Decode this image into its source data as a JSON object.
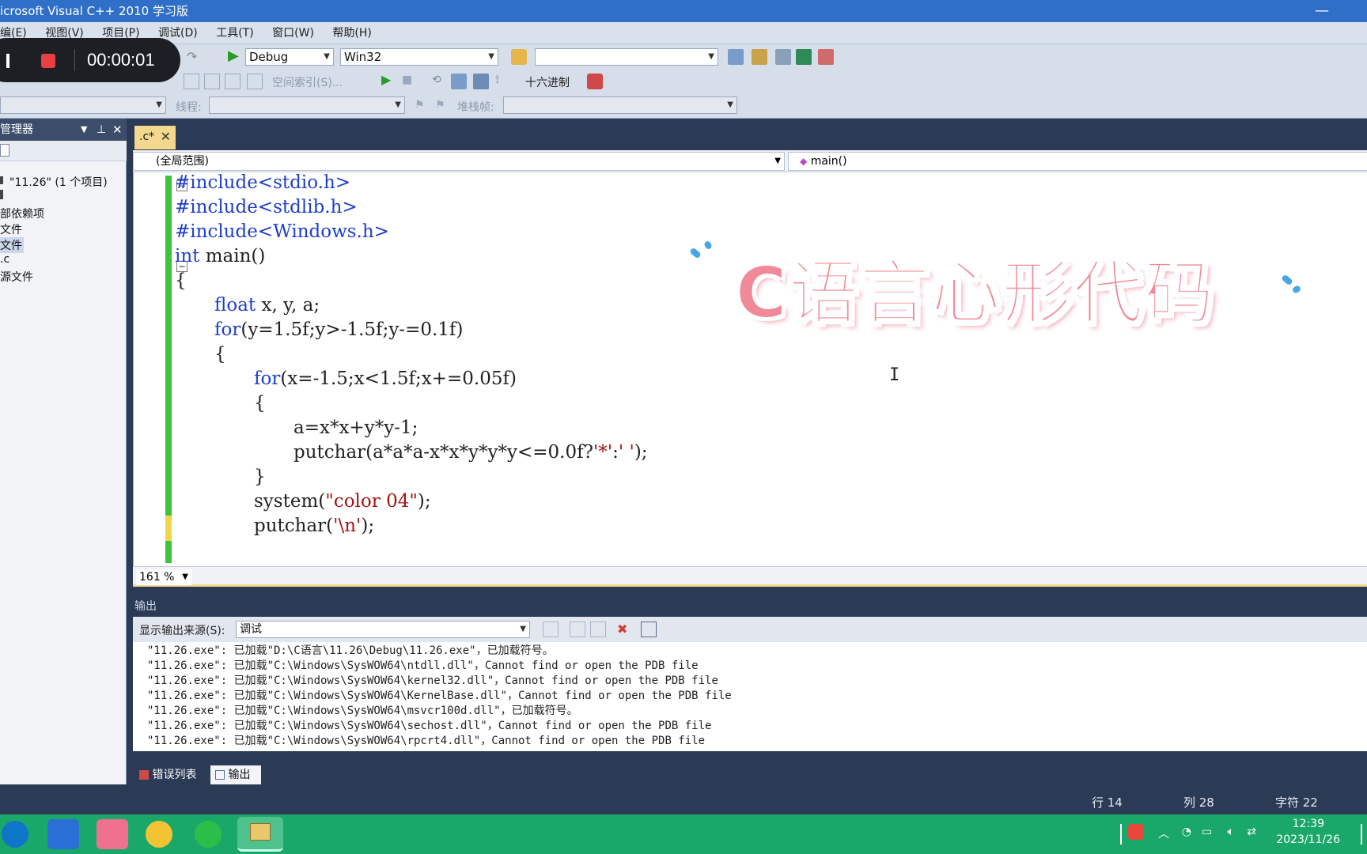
{
  "window": {
    "title": "icrosoft Visual C++ 2010 学习版"
  },
  "menu": [
    "编(E)",
    "视图(V)",
    "项目(P)",
    "调试(D)",
    "工具(T)",
    "窗口(W)",
    "帮助(H)"
  ],
  "recorder": {
    "time": "00:00:01"
  },
  "toolbar": {
    "config": "Debug",
    "platform": "Win32",
    "find_value": "",
    "index_label": "空间索引(S)...",
    "hex_label": "十六进制",
    "thread_label": "线程:",
    "stack_label": "堆栈帧:"
  },
  "solution_explorer": {
    "title": "管理器",
    "items": [
      {
        "label": "\"11.26\" (1 个项目)"
      },
      {
        "label": ""
      },
      {
        "label": "部依赖项"
      },
      {
        "label": "文件"
      },
      {
        "label": "文件"
      },
      {
        "label": ".c"
      },
      {
        "label": "源文件"
      }
    ]
  },
  "editor": {
    "tab_label": ".c*",
    "scope": "(全局范围)",
    "function": "main()",
    "zoom": "161 %",
    "lines": [
      {
        "indent": 0,
        "parts": [
          [
            "pp",
            "#include<stdio.h>"
          ]
        ]
      },
      {
        "indent": 0,
        "parts": [
          [
            "pp",
            "#include<stdlib.h>"
          ]
        ]
      },
      {
        "indent": 0,
        "parts": [
          [
            "pp",
            "#include<Windows.h>"
          ]
        ]
      },
      {
        "indent": 0,
        "parts": [
          [
            "kw",
            "int"
          ],
          [
            "",
            " main()"
          ]
        ]
      },
      {
        "indent": 0,
        "parts": [
          [
            "",
            "{"
          ]
        ]
      },
      {
        "indent": 1,
        "parts": [
          [
            "kw",
            "float"
          ],
          [
            "",
            " x, y, a;"
          ]
        ]
      },
      {
        "indent": 1,
        "parts": [
          [
            "kw",
            "for"
          ],
          [
            "",
            "(y=1.5f;y>-1.5f;y-=0.1f)"
          ]
        ]
      },
      {
        "indent": 1,
        "parts": [
          [
            "",
            "{"
          ]
        ]
      },
      {
        "indent": 2,
        "parts": [
          [
            "kw",
            "for"
          ],
          [
            "",
            "(x=-1.5;x<1.5f;x+=0.05f)"
          ]
        ]
      },
      {
        "indent": 2,
        "parts": [
          [
            "",
            "{"
          ]
        ]
      },
      {
        "indent": 3,
        "parts": [
          [
            "",
            "a=x*x+y*y-1;"
          ]
        ]
      },
      {
        "indent": 3,
        "parts": [
          [
            "",
            "putchar(a*a*a-x*x*y*y*y<=0.0f?"
          ],
          [
            "str",
            "'*'"
          ],
          [
            "",
            ":"
          ],
          [
            "str",
            "' '"
          ],
          [
            "",
            ");"
          ]
        ]
      },
      {
        "indent": 2,
        "parts": [
          [
            "",
            "}"
          ]
        ]
      },
      {
        "indent": 2,
        "parts": [
          [
            "",
            "system("
          ],
          [
            "str",
            "\"color 04\""
          ],
          [
            "",
            ");"
          ]
        ]
      },
      {
        "indent": 2,
        "parts": [
          [
            "",
            "putchar("
          ],
          [
            "str",
            "'\\n'"
          ],
          [
            "",
            ");"
          ]
        ]
      }
    ]
  },
  "overlay": {
    "title": "C语言心形代码"
  },
  "output": {
    "header": "输出",
    "source_label": "显示输出来源(S):",
    "source_value": "调试",
    "lines": [
      "\"11.26.exe\": 已加载\"D:\\C语言\\11.26\\Debug\\11.26.exe\"，已加载符号。",
      "\"11.26.exe\": 已加载\"C:\\Windows\\SysWOW64\\ntdll.dll\"，Cannot find or open the PDB file",
      "\"11.26.exe\": 已加载\"C:\\Windows\\SysWOW64\\kernel32.dll\"，Cannot find or open the PDB file",
      "\"11.26.exe\": 已加载\"C:\\Windows\\SysWOW64\\KernelBase.dll\"，Cannot find or open the PDB file",
      "\"11.26.exe\": 已加载\"C:\\Windows\\SysWOW64\\msvcr100d.dll\"，已加载符号。",
      "\"11.26.exe\": 已加载\"C:\\Windows\\SysWOW64\\sechost.dll\"，Cannot find or open the PDB file",
      "\"11.26.exe\": 已加载\"C:\\Windows\\SysWOW64\\rpcrt4.dll\"，Cannot find or open the PDB file"
    ]
  },
  "bottom_tabs": {
    "errors": "错误列表",
    "output": "输出"
  },
  "status": {
    "row": "行 14",
    "col": "列 28",
    "char": "字符 22"
  },
  "tray": {
    "time": "12:39",
    "date": "2023/11/26"
  },
  "colors": {
    "accent": "#2f6fc7",
    "taskbar": "#1aa86a",
    "tab_active": "#f4d88e",
    "overlay_pink": "#f08a98"
  }
}
